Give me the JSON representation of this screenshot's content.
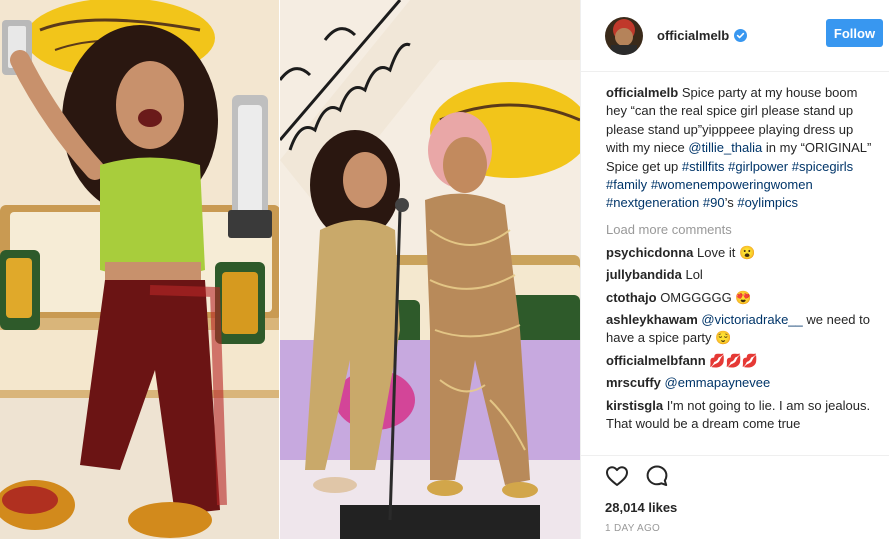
{
  "post": {
    "username": "officialmelb",
    "follow_label": "Follow",
    "caption_parts": [
      {
        "text": "Spice party at my house boom hey “can the real spice girl please stand up please stand up”yipppeee playing dress up with my niece ",
        "type": "text"
      },
      {
        "text": "@tillie_thalia",
        "type": "tag"
      },
      {
        "text": " in my “ORIGINAL” Spice get up ",
        "type": "text"
      },
      {
        "text": "#stillfits",
        "type": "tag"
      },
      {
        "text": " ",
        "type": "text"
      },
      {
        "text": "#girlpower",
        "type": "tag"
      },
      {
        "text": " ",
        "type": "text"
      },
      {
        "text": "#spicegirls",
        "type": "tag"
      },
      {
        "text": " ",
        "type": "text"
      },
      {
        "text": "#family",
        "type": "tag"
      },
      {
        "text": " ",
        "type": "text"
      },
      {
        "text": "#womenempoweringwomen",
        "type": "tag"
      },
      {
        "text": " ",
        "type": "text"
      },
      {
        "text": "#nextgeneration",
        "type": "tag"
      },
      {
        "text": " ",
        "type": "text"
      },
      {
        "text": "#90",
        "type": "tag"
      },
      {
        "text": "’s ",
        "type": "text"
      },
      {
        "text": "#oylimpics",
        "type": "tag"
      }
    ],
    "load_more_label": "Load more comments",
    "comments": [
      {
        "user": "psychicdonna",
        "parts": [
          {
            "text": "Love it 😮",
            "type": "text"
          }
        ]
      },
      {
        "user": "jullybandida",
        "parts": [
          {
            "text": "Lol",
            "type": "text"
          }
        ]
      },
      {
        "user": "ctothajo",
        "parts": [
          {
            "text": "OMGGGGG 😍",
            "type": "text"
          }
        ]
      },
      {
        "user": "ashleykhawam",
        "parts": [
          {
            "text": "@victoriadrake__",
            "type": "tag"
          },
          {
            "text": " we need to have a spice party 😌",
            "type": "text"
          }
        ]
      },
      {
        "user": "officialmelbfann",
        "parts": [
          {
            "text": "💋💋💋",
            "type": "text"
          }
        ]
      },
      {
        "user": "mrscuffy",
        "parts": [
          {
            "text": "@emmapaynevee",
            "type": "tag"
          }
        ]
      },
      {
        "user": "kirstisgla",
        "parts": [
          {
            "text": "I'm not going to lie. I am so jealous. That would be a dream come true",
            "type": "text"
          }
        ]
      }
    ],
    "likes": "28,014 likes",
    "time": "1 DAY AGO",
    "icons": {
      "like": "heart-icon",
      "comment": "comment-icon",
      "verified": "verified-badge-icon"
    },
    "colors": {
      "accent": "#3897f0",
      "tag": "#003569",
      "muted": "#999999",
      "verified": "#3897f0"
    }
  }
}
